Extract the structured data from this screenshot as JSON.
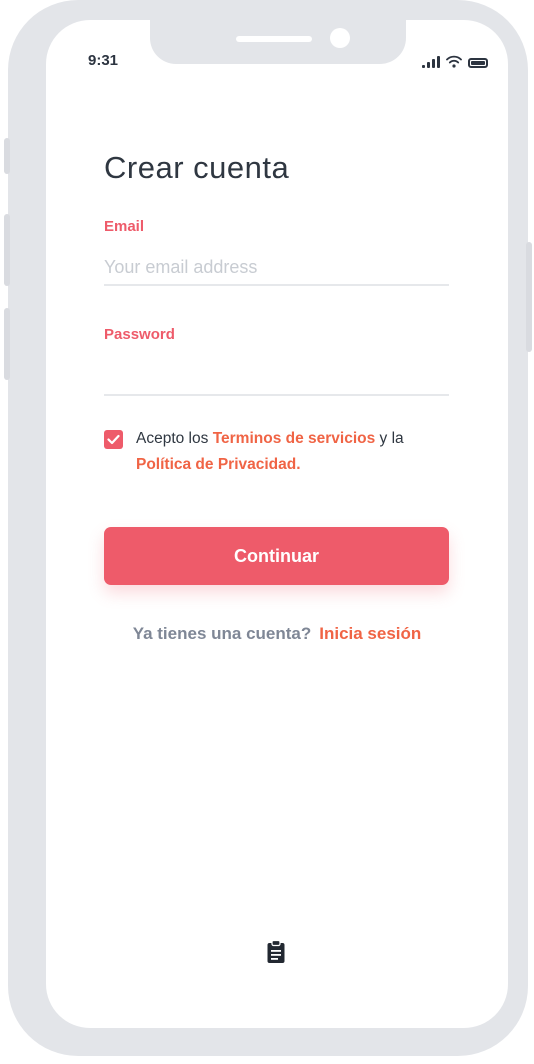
{
  "status_bar": {
    "time": "9:31",
    "icons": [
      "signal-icon",
      "wifi-icon",
      "battery-icon"
    ]
  },
  "screen": {
    "title": "Crear cuenta",
    "email": {
      "label": "Email",
      "placeholder": "Your email address",
      "value": ""
    },
    "password": {
      "label": "Password",
      "placeholder": "",
      "value": ""
    },
    "consent": {
      "checked": true,
      "prefix": "Acepto los",
      "terms_link": "Terminos de servicios",
      "middle": "y la",
      "privacy_link": "Política de Privacidad."
    },
    "continue_label": "Continuar",
    "signin": {
      "question": "Ya tienes una cuenta?",
      "link": "Inicia sesión"
    }
  },
  "colors": {
    "accent": "#ee5b6a",
    "link": "#f06445",
    "frame": "#e3e5e9",
    "text": "#2f3741",
    "muted": "#7f8796"
  },
  "bottom_icon": "clipboard-icon"
}
